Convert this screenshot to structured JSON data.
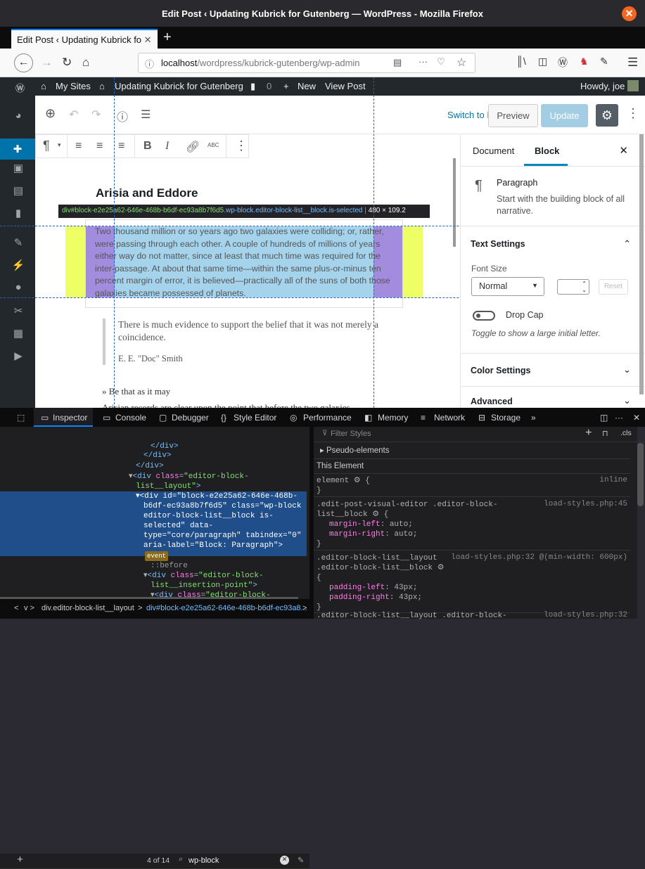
{
  "window": {
    "title": "Edit Post ‹ Updating Kubrick for Gutenberg — WordPress - Mozilla Firefox"
  },
  "tab": {
    "label": "Edit Post ‹ Updating Kubrick fo"
  },
  "url": {
    "host": "localhost",
    "path": "/wordpress/kubrick-gutenberg/wp-admin"
  },
  "adminbar": {
    "mysites": "My Sites",
    "site": "Updating Kubrick for Gutenberg",
    "comments": "0",
    "new": "New",
    "view": "View Post",
    "howdy": "Howdy, joe"
  },
  "editor": {
    "switch_draft": "Switch to Draft",
    "preview": "Preview",
    "update": "Update"
  },
  "content": {
    "heading": "Arisia and Eddore",
    "tooltip_id": "div#block-e2e25a62-646e-468b-b6df-ec93a8b7f6d5",
    "tooltip_class": ".wp-block.editor-block-list__block.is-selected",
    "tooltip_size": "480 × 109.2",
    "paragraph": "Two thousand million or so years ago two galaxies were colliding; or, rather, were passing through each other. A couple of hundreds of millions of years either way do not matter, since at least that much time was required for the inter-passage. At about that same time—within the same plus-or-minus ten percent margin of error, it is believed—practically all of the suns of both those galaxies became possessed of planets.",
    "quote": "There is much evidence to support the belief that it was not merely a coincidence.",
    "cite": "E. E. \"Doc\" Smith",
    "bethat": "» Be that as it may",
    "nextline": "Arisian records are clear upon the point that before the two galaxies"
  },
  "settings": {
    "tab_document": "Document",
    "tab_block": "Block",
    "block_name": "Paragraph",
    "block_desc": "Start with the building block of all narrative.",
    "text_settings": "Text Settings",
    "font_size": "Font Size",
    "font_value": "Normal",
    "reset": "Reset",
    "drop_cap": "Drop Cap",
    "drop_hint": "Toggle to show a large initial letter.",
    "color_settings": "Color Settings",
    "advanced": "Advanced"
  },
  "devtools": {
    "tabs": [
      "Inspector",
      "Console",
      "Debugger",
      "Style Editor",
      "Performance",
      "Memory",
      "Network",
      "Storage"
    ],
    "search_count": "4 of 14",
    "search_value": "wp-block",
    "filter_placeholder": "Filter Styles",
    "pseudo": "Pseudo-elements",
    "this_element": "This Element",
    "cls": ".cls",
    "breadcrumb1": "div.editor-block-list__layout",
    "breadcrumb2": "div#block-e2e25a62-646e-468b-b6df-ec93a8..."
  }
}
